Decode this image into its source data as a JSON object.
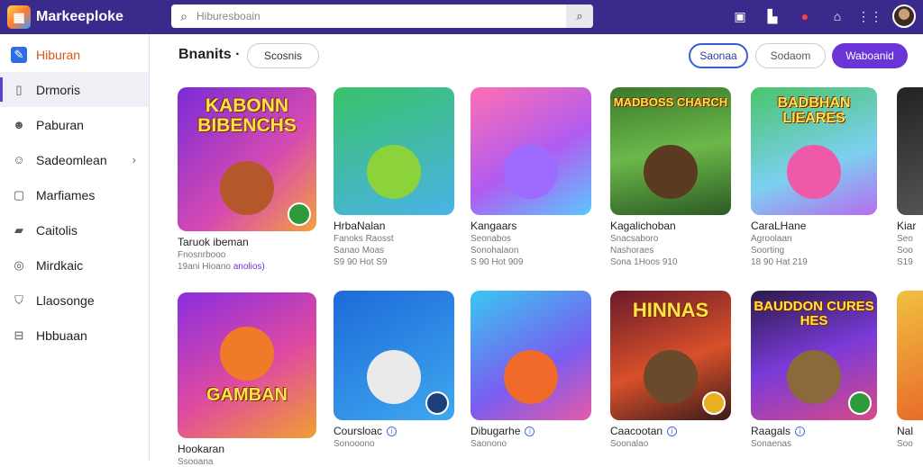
{
  "app": {
    "title": "Markeeploke"
  },
  "search": {
    "placeholder": "Hiburesboain"
  },
  "sidebar": {
    "items": [
      {
        "label": "Hiburan",
        "icon": "app-logo-icon"
      },
      {
        "label": "Drmoris",
        "icon": "list-icon"
      },
      {
        "label": "Paburan",
        "icon": "people-icon"
      },
      {
        "label": "Sadeomlean",
        "icon": "group-icon",
        "has_chevron": true
      },
      {
        "label": "Marfiames",
        "icon": "video-icon"
      },
      {
        "label": "Caitolis",
        "icon": "bag-icon"
      },
      {
        "label": "Mirdkaic",
        "icon": "coin-icon"
      },
      {
        "label": "Llaosonge",
        "icon": "shield-icon"
      },
      {
        "label": "Hbbuaan",
        "icon": "cart-icon"
      }
    ]
  },
  "filters": {
    "title": "Bnanits ·",
    "pill_1": "Scosnis",
    "pill_2": "Saonaa",
    "pill_3": "Sodaom",
    "pill_4": "Waboanid"
  },
  "row1": [
    {
      "thumb_title": "KABONN BIBENCHS",
      "name": "Taruok ibeman",
      "sub1": "Fnosnrbooo",
      "sub2": "19ani Hioano",
      "extra": "anolios)"
    },
    {
      "thumb_title": "",
      "name": "HrbaNalan",
      "sub1": "Fanoks Raosst",
      "sub2": "Sanao Moas",
      "sub3": "S9 90 Hot S9"
    },
    {
      "thumb_title": "",
      "name": "Kangaars",
      "sub1": "Seonabos",
      "sub2": "Sonohalaon",
      "sub3": "S 90 Hot 909"
    },
    {
      "thumb_title": "MADBOSS CHARCH",
      "name": "Kagalichoban",
      "sub1": "Snacsaboro",
      "sub2": "Nashoraes",
      "sub3": "Sona 1Hoos 910"
    },
    {
      "thumb_title": "BADBHAN LIEARES",
      "name": "CaraLHane",
      "sub1": "Agroolaan",
      "sub2": "Soorting",
      "sub3": "18 90 Hat 219"
    },
    {
      "thumb_title": "",
      "name": "Kiar",
      "sub1": "Seo",
      "sub2": "Soo",
      "sub3": "S19"
    }
  ],
  "row2": [
    {
      "thumb_title": "GAMBAN",
      "name": "Hookaran",
      "sub1": "Ssooana"
    },
    {
      "thumb_title": "",
      "name": "Coursloac",
      "sub1": "Sonooono",
      "has_info": true
    },
    {
      "thumb_title": "",
      "name": "Dibugarhe",
      "sub1": "Saonono",
      "has_info": true
    },
    {
      "thumb_title": "HINNAS",
      "name": "Caacootan",
      "sub1": "Soonalao",
      "has_info": true
    },
    {
      "thumb_title": "BAUDDON CURES HES",
      "name": "Raagals",
      "sub1": "Sonaenas",
      "has_info": true
    },
    {
      "thumb_title": "",
      "name": "Nal",
      "sub1": "Soo"
    }
  ]
}
